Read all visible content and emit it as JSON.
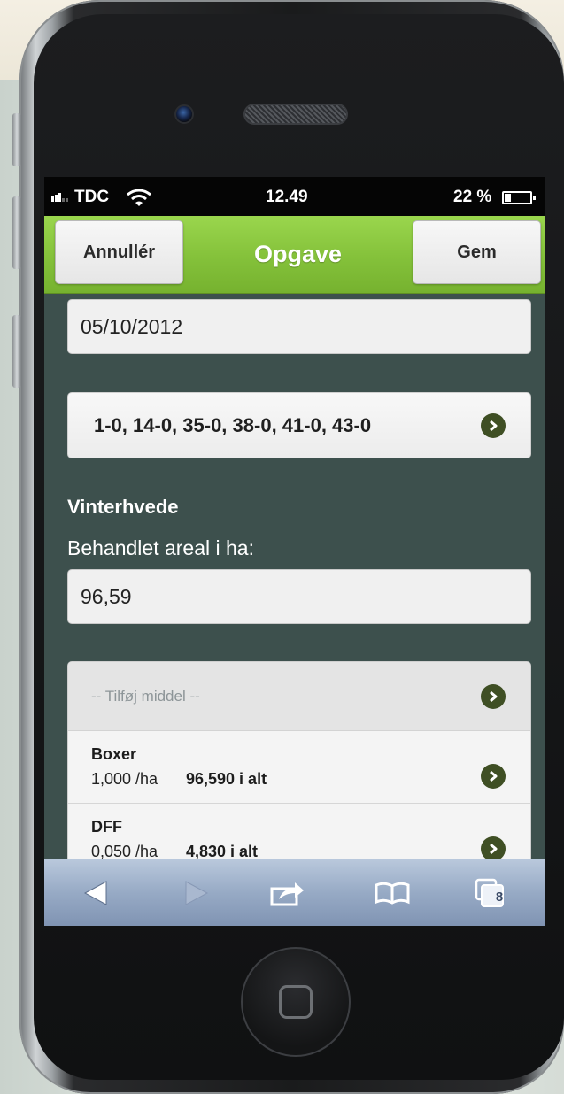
{
  "status_bar": {
    "carrier": "TDC",
    "time": "12.49",
    "battery": "22 %"
  },
  "header": {
    "cancel_label": "Annullér",
    "title": "Opgave",
    "save_label": "Gem"
  },
  "form": {
    "date_value": "05/10/2012",
    "fields_selection": "1-0, 14-0, 35-0, 38-0, 41-0, 43-0",
    "crop_label": "Vinterhvede",
    "area_label": "Behandlet areal i ha:",
    "area_value": "96,59"
  },
  "products": {
    "add_placeholder": "--  Tilføj middel  --",
    "items": [
      {
        "name": "Boxer",
        "rate": "1,000 /ha",
        "total": "96,590 i alt"
      },
      {
        "name": "DFF",
        "rate": "0,050 /ha",
        "total": "4,830 i alt"
      }
    ]
  },
  "toolbar": {
    "tabs_count": "8"
  },
  "colors": {
    "header_green": "#84c13a",
    "page_background": "#3d504d",
    "arrow_circle": "#3f4f24",
    "toolbar_blue": "#97aac5"
  },
  "icons": {
    "select_arrow": "chevron-right-circle-icon",
    "back": "back-arrow-icon",
    "forward": "forward-arrow-icon",
    "share": "share-icon",
    "bookmarks": "bookmarks-icon",
    "tabs": "tabs-icon"
  }
}
